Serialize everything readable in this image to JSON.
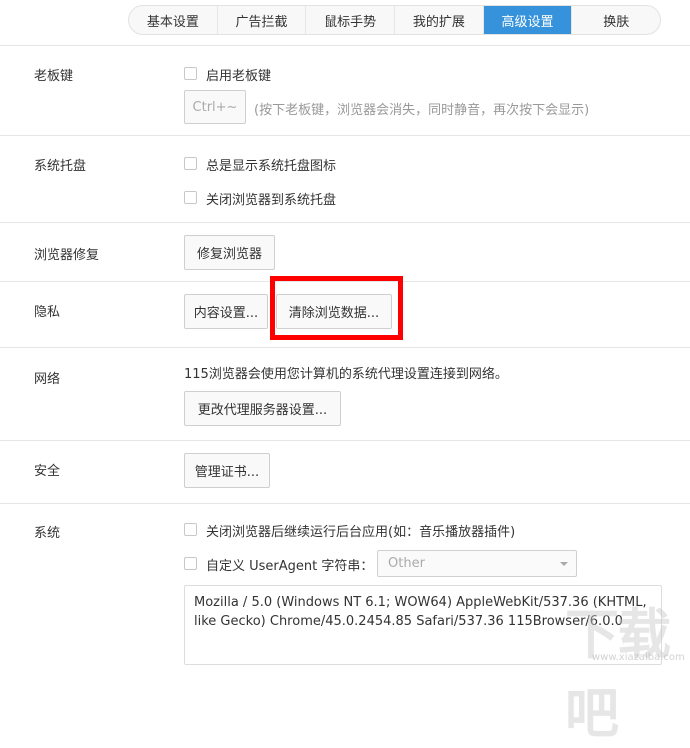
{
  "tabs": [
    {
      "label": "基本设置"
    },
    {
      "label": "广告拦截"
    },
    {
      "label": "鼠标手势"
    },
    {
      "label": "我的扩展"
    },
    {
      "label": "高级设置",
      "active": true
    },
    {
      "label": "换肤"
    }
  ],
  "boss_key": {
    "label": "老板键",
    "enable": "启用老板键",
    "shortcut": "Ctrl+~",
    "hint": "(按下老板键，浏览器会消失，同时静音，再次按下会显示)"
  },
  "tray": {
    "label": "系统托盘",
    "always_show": "总是显示系统托盘图标",
    "close_to_tray": "关闭浏览器到系统托盘"
  },
  "repair": {
    "label": "浏览器修复",
    "button": "修复浏览器"
  },
  "privacy": {
    "label": "隐私",
    "content_settings": "内容设置...",
    "clear_data": "清除浏览数据..."
  },
  "network": {
    "label": "网络",
    "desc": "115浏览器会使用您计算机的系统代理设置连接到网络。",
    "button": "更改代理服务器设置..."
  },
  "security": {
    "label": "安全",
    "button": "管理证书..."
  },
  "system": {
    "label": "系统",
    "background_apps": "关闭浏览器后继续运行后台应用(如：音乐播放器插件)",
    "custom_ua": "自定义 UserAgent 字符串：",
    "ua_select": "Other",
    "ua_text": "Mozilla / 5.0 (Windows NT 6.1; WOW64) AppleWebKit/537.36 (KHTML, like Gecko) Chrome/45.0.2454.85 Safari/537.36 115Browser/6.0.0"
  },
  "watermark": {
    "text": "下载吧",
    "url": "www.xiazaiba.com"
  },
  "colors": {
    "accent": "#3592db",
    "highlight": "#ff0000"
  }
}
